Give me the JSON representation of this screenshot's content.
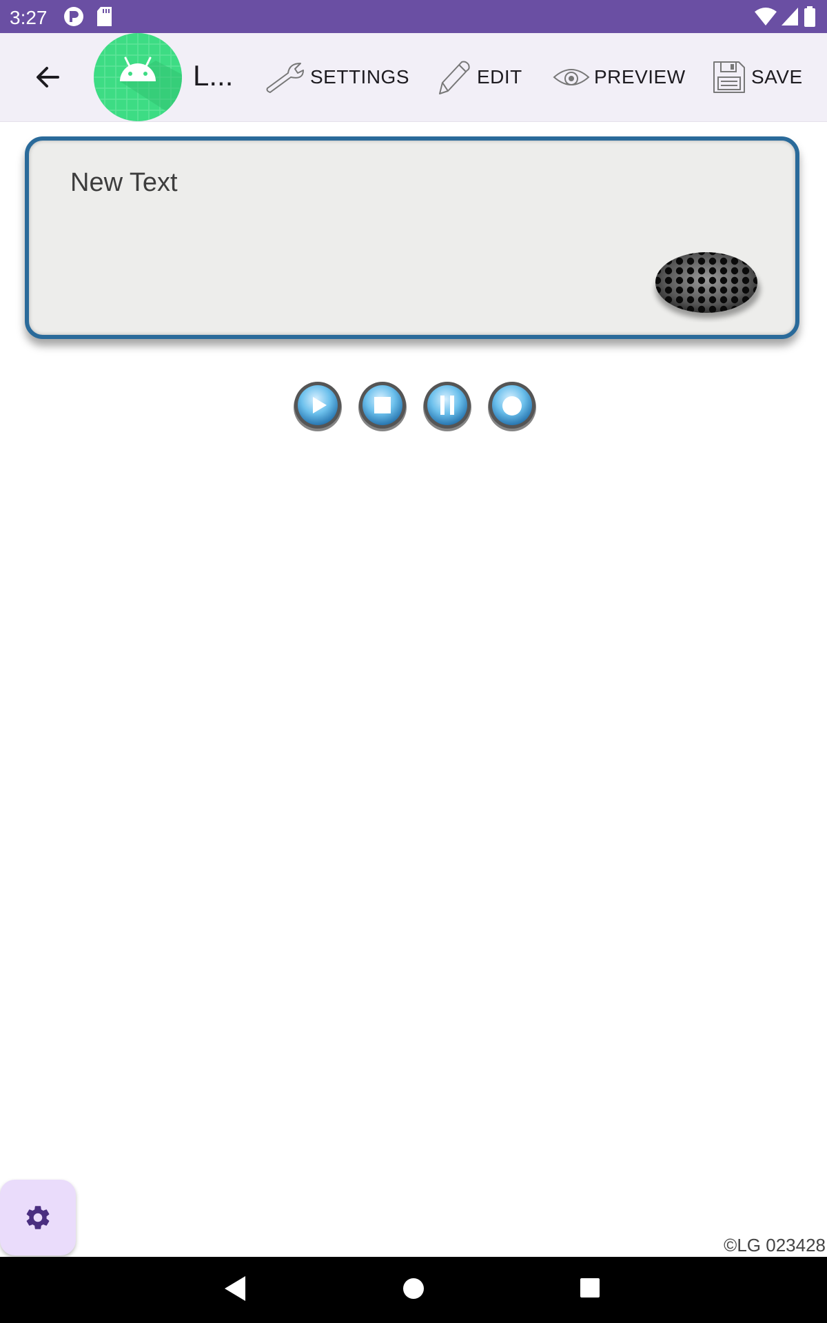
{
  "status_bar": {
    "time": "3:27",
    "left_icons": [
      "app-notification-icon",
      "sd-card-icon"
    ],
    "right_icons": [
      "wifi-icon",
      "cell-signal-icon",
      "battery-icon"
    ],
    "background_color": "#6a4fa3"
  },
  "app_bar": {
    "title": "L...",
    "background_color": "#f2eff7",
    "actions": [
      {
        "label": "SETTINGS",
        "icon": "wrench-icon"
      },
      {
        "label": "EDIT",
        "icon": "pencil-icon"
      },
      {
        "label": "PREVIEW",
        "icon": "eye-icon"
      },
      {
        "label": "SAVE",
        "icon": "floppy-disk-icon"
      }
    ]
  },
  "panel": {
    "text": "New Text",
    "border_color": "#2a6a9a",
    "background_color": "#ededeb"
  },
  "controls": [
    {
      "name": "play",
      "icon": "play-icon"
    },
    {
      "name": "stop",
      "icon": "stop-icon"
    },
    {
      "name": "pause",
      "icon": "pause-icon"
    },
    {
      "name": "record",
      "icon": "record-icon"
    }
  ],
  "fab": {
    "icon": "gear-icon",
    "background_color": "#eadcfb",
    "icon_color": "#4a2e80"
  },
  "footer": {
    "copyright": "©LG 023428"
  },
  "nav_bar": {
    "buttons": [
      "back",
      "home",
      "recents"
    ]
  }
}
